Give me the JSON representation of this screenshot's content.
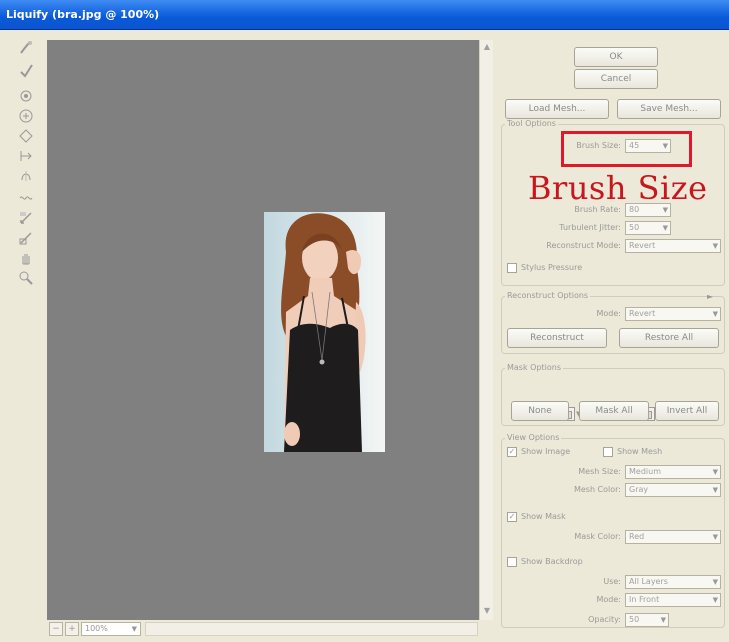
{
  "window": {
    "title": "Liquify (bra.jpg @ 100%)"
  },
  "toolbar": {
    "tools": [
      {
        "name": "forward-warp-icon"
      },
      {
        "name": "reconstruct-icon"
      },
      {
        "name": "twirl-clockwise-icon"
      },
      {
        "name": "pucker-icon"
      },
      {
        "name": "bloat-icon"
      },
      {
        "name": "push-left-icon"
      },
      {
        "name": "mirror-icon"
      },
      {
        "name": "turbulence-icon"
      },
      {
        "name": "freeze-mask-icon"
      },
      {
        "name": "thaw-mask-icon"
      },
      {
        "name": "hand-icon"
      },
      {
        "name": "zoom-icon"
      }
    ]
  },
  "statusbar": {
    "zoom_minus": "−",
    "zoom_plus": "+",
    "zoom": "100%"
  },
  "buttons": {
    "ok": "OK",
    "cancel": "Cancel",
    "load_mesh": "Load Mesh...",
    "save_mesh": "Save Mesh...",
    "reconstruct": "Reconstruct",
    "restore_all": "Restore All",
    "none": "None",
    "mask_all": "Mask All",
    "invert_all": "Invert All"
  },
  "tool_options": {
    "title": "Tool Options",
    "brush_size_label": "Brush Size:",
    "brush_size": "45",
    "brush_rate_label": "Brush Rate:",
    "brush_rate": "80",
    "turbulent_jitter_label": "Turbulent Jitter:",
    "turbulent_jitter": "50",
    "reconstruct_mode_label": "Reconstruct Mode:",
    "reconstruct_mode": "Revert",
    "stylus_pressure": "Stylus Pressure"
  },
  "reconstruct_options": {
    "title": "Reconstruct Options",
    "mode_label": "Mode:",
    "mode": "Revert"
  },
  "mask_options": {
    "title": "Mask Options"
  },
  "view_options": {
    "title": "View Options",
    "show_image": "Show Image",
    "show_mesh": "Show Mesh",
    "mesh_size_label": "Mesh Size:",
    "mesh_size": "Medium",
    "mesh_color_label": "Mesh Color:",
    "mesh_color": "Gray",
    "show_mask": "Show Mask",
    "mask_color_label": "Mask Color:",
    "mask_color": "Red",
    "show_backdrop": "Show Backdrop",
    "use_label": "Use:",
    "use": "All Layers",
    "mode_label": "Mode:",
    "mode": "In Front",
    "opacity_label": "Opacity:",
    "opacity": "50"
  },
  "annotation": {
    "text": "Brush Size",
    "color": "#c8161e"
  }
}
